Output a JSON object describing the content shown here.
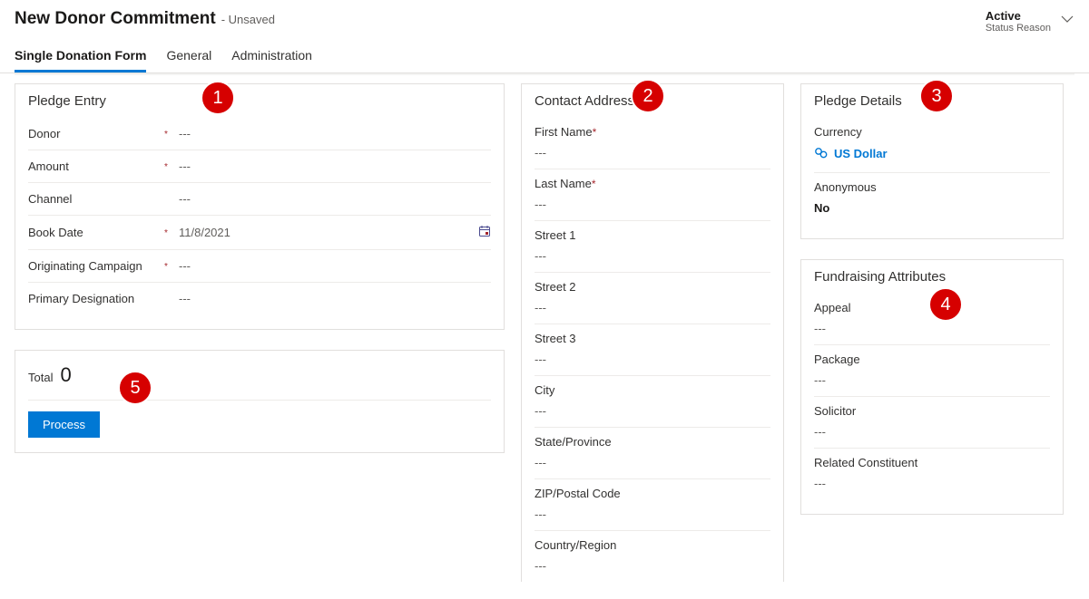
{
  "header": {
    "title": "New Donor Commitment",
    "sub": "- Unsaved",
    "status_value": "Active",
    "status_label": "Status Reason"
  },
  "tabs": {
    "t0": "Single Donation Form",
    "t1": "General",
    "t2": "Administration"
  },
  "badges": {
    "b1": "1",
    "b2": "2",
    "b3": "3",
    "b4": "4",
    "b5": "5"
  },
  "pledge_entry": {
    "title": "Pledge Entry",
    "fields": {
      "donor": {
        "label": "Donor",
        "value": "---",
        "required": true
      },
      "amount": {
        "label": "Amount",
        "value": "---",
        "required": true
      },
      "channel": {
        "label": "Channel",
        "value": "---",
        "required": false
      },
      "book_date": {
        "label": "Book Date",
        "value": "11/8/2021",
        "required": true
      },
      "orig_campaign": {
        "label": "Originating Campaign",
        "value": "---",
        "required": true
      },
      "primary_designation": {
        "label": "Primary Designation",
        "value": "---",
        "required": false
      }
    }
  },
  "total_panel": {
    "label": "Total",
    "value": "0",
    "button": "Process"
  },
  "contact": {
    "title": "Contact Address",
    "fields": {
      "first_name": {
        "label": "First Name",
        "value": "---",
        "required": true
      },
      "last_name": {
        "label": "Last Name",
        "value": "---",
        "required": true
      },
      "street1": {
        "label": "Street 1",
        "value": "---"
      },
      "street2": {
        "label": "Street 2",
        "value": "---"
      },
      "street3": {
        "label": "Street 3",
        "value": "---"
      },
      "city": {
        "label": "City",
        "value": "---"
      },
      "state": {
        "label": "State/Province",
        "value": "---"
      },
      "zip": {
        "label": "ZIP/Postal Code",
        "value": "---"
      },
      "country": {
        "label": "Country/Region",
        "value": "---"
      }
    }
  },
  "pledge_details": {
    "title": "Pledge Details",
    "currency": {
      "label": "Currency",
      "value": "US Dollar"
    },
    "anonymous": {
      "label": "Anonymous",
      "value": "No"
    }
  },
  "fundraising": {
    "title": "Fundraising Attributes",
    "fields": {
      "appeal": {
        "label": "Appeal",
        "value": "---"
      },
      "package": {
        "label": "Package",
        "value": "---"
      },
      "solicitor": {
        "label": "Solicitor",
        "value": "---"
      },
      "related": {
        "label": "Related Constituent",
        "value": "---"
      }
    }
  },
  "req_mark": "*"
}
